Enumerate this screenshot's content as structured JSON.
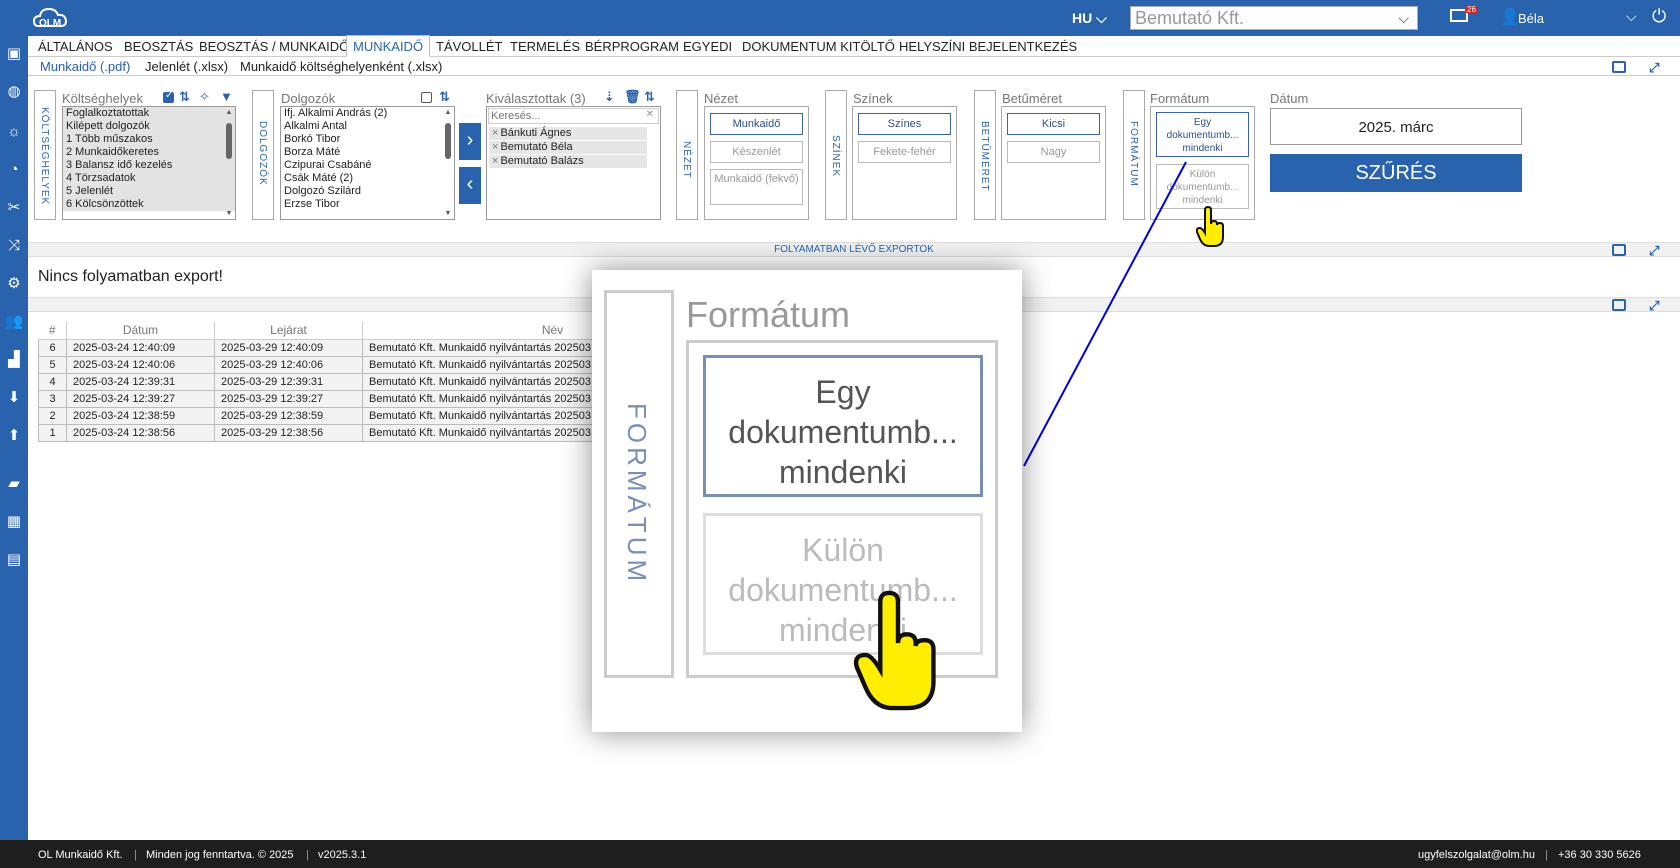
{
  "topbar": {
    "logo": "OLM",
    "lang": "HU",
    "company": "Bemutató Kft.",
    "mail_count": "26",
    "user": "Béla"
  },
  "menu": [
    "ÁLTALÁNOS",
    "BEOSZTÁS",
    "BEOSZTÁS / MUNKAIDŐ",
    "MUNKAIDŐ",
    "TÁVOLLÉT",
    "TERMELÉS",
    "BÉRPROGRAM",
    "EGYEDI",
    "DOKUMENTUM KITÖLTŐ",
    "HELYSZÍNI BEJELENTKEZÉS"
  ],
  "subtabs": [
    "Munkaidő (.pdf)",
    "Jelenlét (.xlsx)",
    "Munkaidő költséghelyenként (.xlsx)"
  ],
  "koltseghelyek": {
    "vtab": "KÖLTSÉGHELYEK",
    "title": "Költséghelyek",
    "items": [
      "Foglalkoztatottak",
      "Kilépett dolgozók",
      "1 Több műszakos",
      "2 Munkaidőkeretes",
      "3 Balansz idő kezelés",
      "4 Törzsadatok",
      "5 Jelenlét",
      "6 Kölcsönzöttek"
    ]
  },
  "dolgozok": {
    "vtab": "DOLGOZÓK",
    "title": "Dolgozók",
    "items": [
      "Ifj. Alkalmi András (2)",
      "Alkalmi Antal",
      "Borkó Tibor",
      "Borza Máté",
      "Czipurai Csabáné",
      "Csák Máté (2)",
      "Dolgozó Szilárd",
      "Erzse Tibor"
    ]
  },
  "kivalasztottak": {
    "title": "Kiválasztottak (3)",
    "search_placeholder": "Keresés...",
    "items": [
      "Bánkuti Ágnes",
      "Bemutató Béla",
      "Bemutató Balázs"
    ]
  },
  "nezet": {
    "vtab": "NÉZET",
    "title": "Nézet",
    "options": [
      "Munkaidő",
      "Készenlét",
      "Munkaidő (fekvő)"
    ]
  },
  "szinek": {
    "vtab": "SZÍNEK",
    "title": "Színek",
    "options": [
      "Színes",
      "Fekete-fehér"
    ]
  },
  "betumeret": {
    "vtab": "BETŰMÉRET",
    "title": "Betűméret",
    "options": [
      "Kicsi",
      "Nagy"
    ]
  },
  "formatum": {
    "vtab": "FORMÁTUM",
    "title": "Formátum",
    "options": [
      "Egy dokumentumb... mindenki",
      "Külön dokumentumb... mindenki"
    ]
  },
  "datum": {
    "title": "Dátum",
    "value": "2025. márc"
  },
  "filter_button": "SZŰRÉS",
  "exports": {
    "title": "FOLYAMATBAN LÉVŐ EXPORTOK",
    "empty": "Nincs folyamatban export!"
  },
  "table": {
    "headers": [
      "#",
      "Dátum",
      "Lejárat",
      "Név"
    ],
    "rows": [
      [
        "6",
        "2025-03-24 12:40:09",
        "2025-03-29 12:40:09",
        "Bemutató Kft. Munkaidő nyilvántartás 202503"
      ],
      [
        "5",
        "2025-03-24 12:40:06",
        "2025-03-29 12:40:06",
        "Bemutató Kft. Munkaidő nyilvántartás 202503"
      ],
      [
        "4",
        "2025-03-24 12:39:31",
        "2025-03-29 12:39:31",
        "Bemutató Kft. Munkaidő nyilvántartás 202503"
      ],
      [
        "3",
        "2025-03-24 12:39:27",
        "2025-03-29 12:39:27",
        "Bemutató Kft. Munkaidő nyilvántartás 202503"
      ],
      [
        "2",
        "2025-03-24 12:38:59",
        "2025-03-29 12:38:59",
        "Bemutató Kft. Munkaidő nyilvántartás 202503"
      ],
      [
        "1",
        "2025-03-24 12:38:56",
        "2025-03-29 12:38:56",
        "Bemutató Kft. Munkaidő nyilvántartás 202503"
      ]
    ]
  },
  "zoom": {
    "vtab": "FORMÁTUM",
    "title": "Formátum",
    "opt1": [
      "Egy",
      "dokumentumb...",
      "mindenki"
    ],
    "opt2": [
      "Külön",
      "dokumentumb...",
      "mindenki"
    ]
  },
  "footer": {
    "company": "OL Munkaidő Kft.",
    "rights": "Minden jog fenntartva. © 2025",
    "version": "v2025.3.1",
    "email": "ugyfelszolgalat@olm.hu",
    "phone": "+36 30 330 5626"
  },
  "colors": {
    "brand": "#2a63ad",
    "footer": "#1e1e1e",
    "callout_line": "#0000dd",
    "cursor": "#ffee00"
  }
}
